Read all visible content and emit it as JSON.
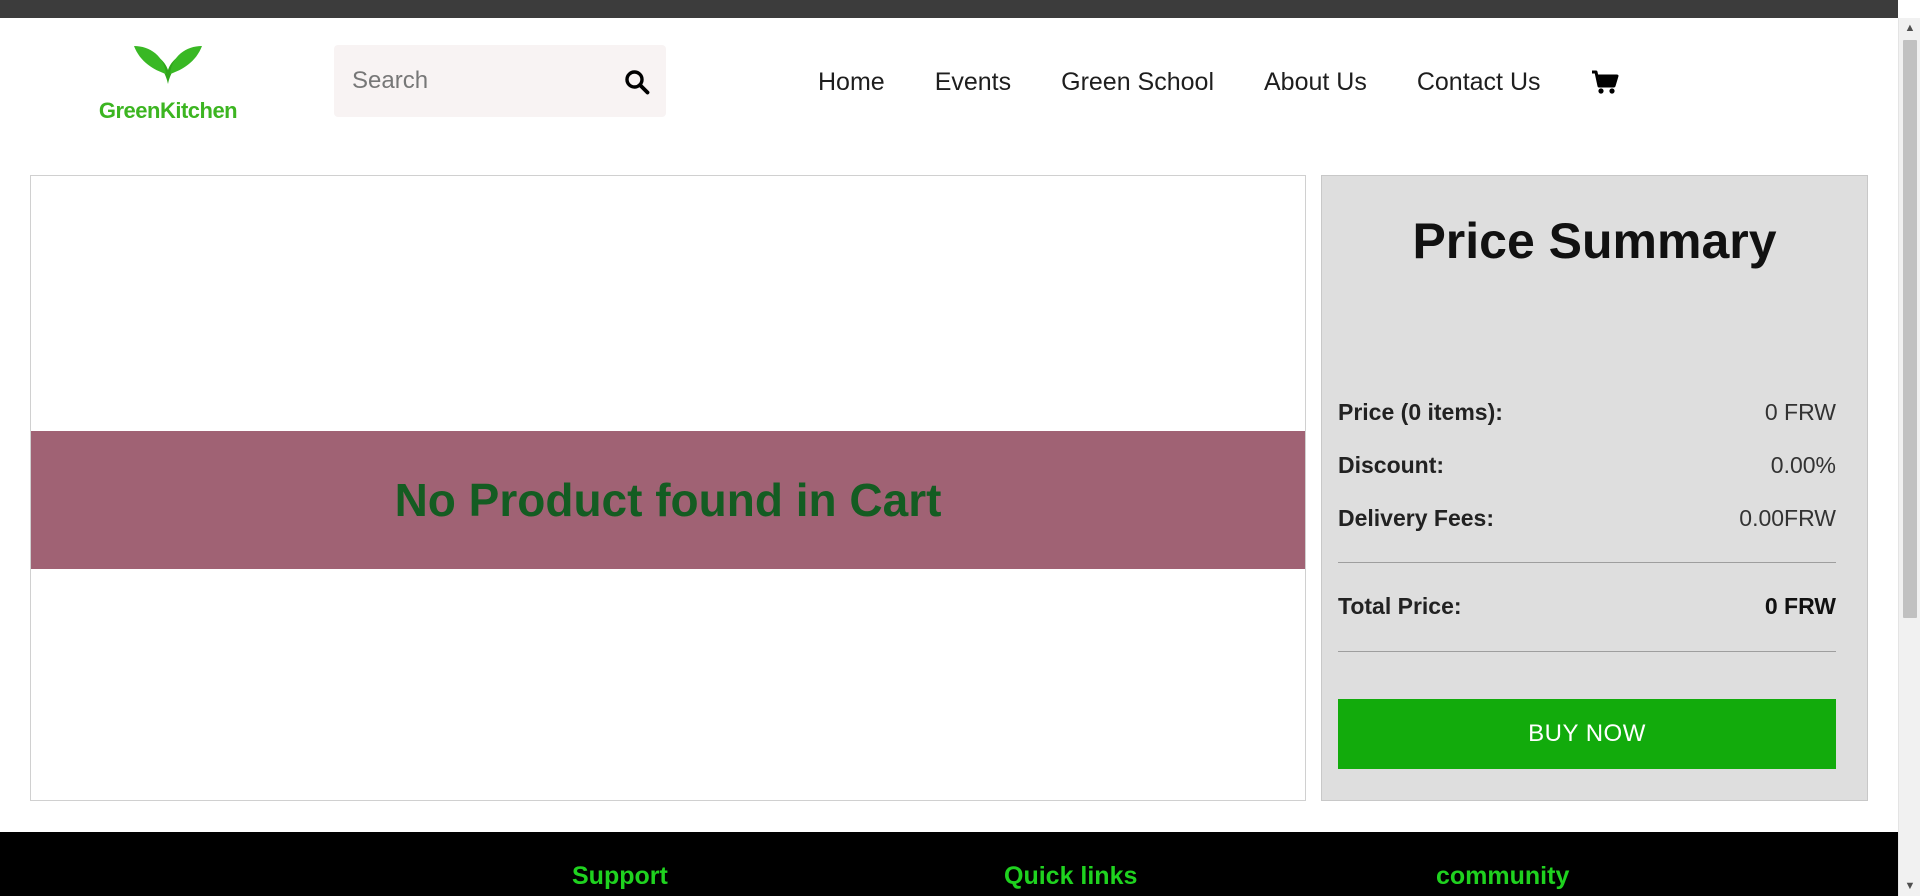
{
  "header": {
    "logo_text": "GreenKitchen",
    "search_placeholder": "Search",
    "nav": [
      {
        "label": "Home"
      },
      {
        "label": "Events"
      },
      {
        "label": "Green School"
      },
      {
        "label": "About Us"
      },
      {
        "label": "Contact Us"
      }
    ],
    "cart_icon": "shopping-cart-icon"
  },
  "cart": {
    "empty_message": "No Product found in Cart",
    "banner_color": "#a06274",
    "message_color": "#145c22"
  },
  "summary": {
    "title": "Price Summary",
    "rows": [
      {
        "label": "Price (0 items):",
        "value": "0 FRW"
      },
      {
        "label": "Discount:",
        "value": "0.00%"
      },
      {
        "label": "Delivery Fees:",
        "value": "0.00FRW"
      }
    ],
    "total": {
      "label": "Total Price:",
      "value": "0 FRW"
    },
    "buy_button": "BUY NOW",
    "button_color": "#12ab0c"
  },
  "footer": {
    "columns": [
      {
        "title": "Support"
      },
      {
        "title": "Quick links"
      },
      {
        "title": "community"
      }
    ],
    "heading_color": "#1fd21f"
  },
  "icons": {
    "search": "search-icon",
    "cart": "shopping-cart-icon",
    "logo": "leaf-logo-icon"
  }
}
